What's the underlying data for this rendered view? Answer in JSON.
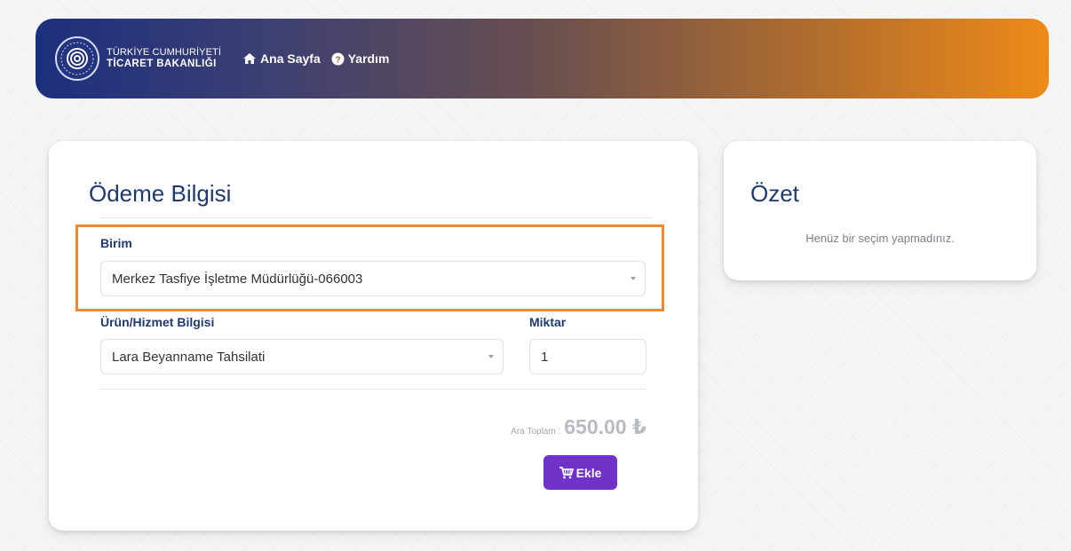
{
  "header": {
    "logo_line1": "TÜRKİYE CUMHURİYETİ",
    "logo_line2": "TİCARET BAKANLIĞI",
    "nav": [
      {
        "label": "Ana Sayfa",
        "icon": "home-icon"
      },
      {
        "label": "Yardım",
        "icon": "question-circle-icon"
      }
    ]
  },
  "payment": {
    "title": "Ödeme Bilgisi",
    "unit_label": "Birim",
    "unit_value": "Merkez Tasfiye İşletme Müdürlüğü-066003",
    "service_label": "Ürün/Hizmet Bilgisi",
    "service_value": "Lara Beyanname Tahsilati",
    "quantity_label": "Miktar",
    "quantity_value": "1",
    "subtotal_label": "Ara Toplam :",
    "subtotal_value": "650.00 ₺",
    "add_button_label": "Ekle"
  },
  "summary": {
    "title": "Özet",
    "empty_message": "Henüz bir seçim yapmadınız."
  },
  "colors": {
    "brand_navy": "#1c2f7d",
    "brand_orange": "#ee8a18",
    "title_blue": "#1f3a6e",
    "highlight_orange": "#ef8a32",
    "button_purple": "#6f33c9"
  }
}
